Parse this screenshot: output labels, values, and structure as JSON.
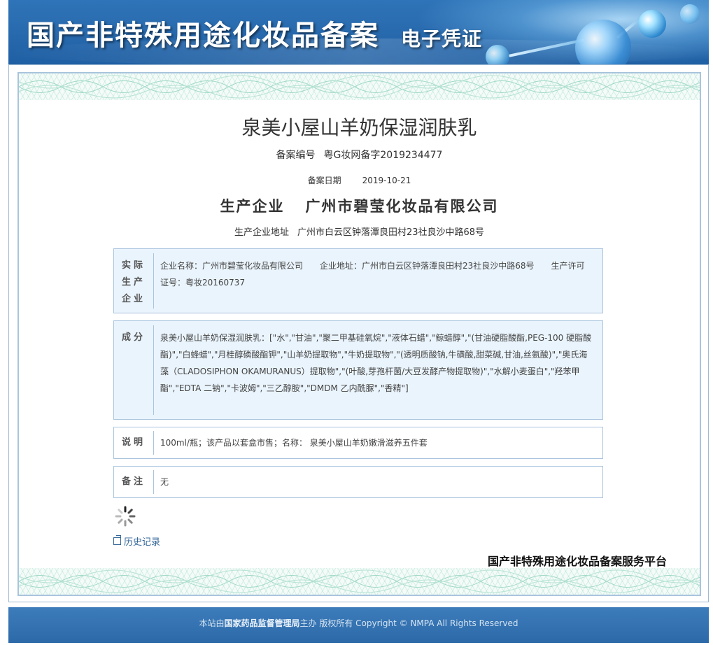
{
  "header": {
    "title": "国产非特殊用途化妆品备案",
    "subtitle": "电子凭证"
  },
  "certificate": {
    "product_name": "泉美小屋山羊奶保湿润肤乳",
    "record_no_label": "备案编号",
    "record_no": "粤G妆网备字2019234477",
    "record_date_label": "备案日期",
    "record_date": "2019-10-21",
    "producer_label": "生产企业",
    "producer": "广州市碧莹化妆品有限公司",
    "producer_addr_label": "生产企业地址",
    "producer_addr": "广州市白云区钟落潭良田村23社良沙中路68号"
  },
  "boxes": {
    "actual": {
      "label": "实际生产企业",
      "content": "企业名称：广州市碧莹化妆品有限公司　　企业地址：广州市白云区钟落潭良田村23社良沙中路68号　　生产许可证号：粤妆20160737"
    },
    "ingredients": {
      "label": "成分",
      "content": "泉美小屋山羊奶保湿润肤乳：[\"水\",\"甘油\",\"聚二甲基硅氧烷\",\"液体石蜡\",\"鲸蜡醇\",\"(甘油硬脂酸酯,PEG-100 硬脂酸酯)\",\"白蜂蜡\",\"月桂醇磷酸酯钾\",\"山羊奶提取物\",\"牛奶提取物\",\"(透明质酸钠,牛磺酸,甜菜碱,甘油,丝氨酸)\",\"奥氏海藻（CLADOSIPHON OKAMURANUS）提取物\",\"(叶酸,芽孢杆菌/大豆发酵产物提取物)\",\"水解小麦蛋白\",\"羟苯甲酯\",\"EDTA 二钠\",\"卡波姆\",\"三乙醇胺\",\"DMDM 乙内酰脲\",\"香精\"]"
    },
    "description": {
      "label": "说明",
      "content": "100ml/瓶；该产品以套盒市售；名称： 泉美小屋山羊奶嫩滑滋养五件套"
    },
    "remark": {
      "label": "备注",
      "content": "无"
    }
  },
  "history_link": "历史记录",
  "platform_name": "国产非特殊用途化妆品备案服务平台",
  "footer": {
    "prefix": "本站由",
    "org": "国家药品监督管理局",
    "suffix": "主办 版权所有 Copyright © NMPA All Rights Reserved"
  },
  "colors": {
    "header_blue": "#2a6cb0",
    "box_fill": "#eaf4fc",
    "box_border": "#a9c4de",
    "link": "#336699"
  }
}
